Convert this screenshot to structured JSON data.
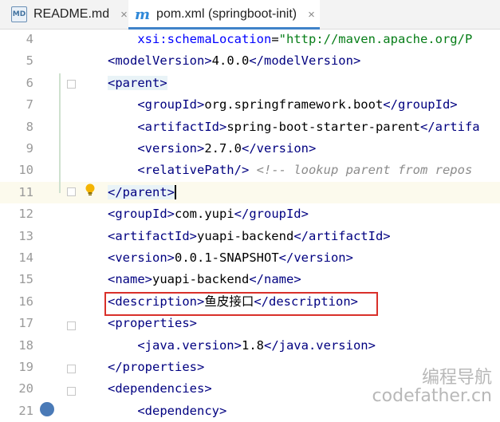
{
  "tabs": [
    {
      "label": "README.md",
      "icon": "markdown-file-icon",
      "close": "×"
    },
    {
      "label": "pom.xml (springboot-init)",
      "icon": "maven-m-icon",
      "close": "×"
    }
  ],
  "md_icon_text": "MD",
  "m_icon_text": "m",
  "lines": [
    {
      "n": "4",
      "t": "    xsi:schemaLocation=\"http://maven.apache.org/P"
    },
    {
      "n": "5",
      "t": "<modelVersion>4.0.0</modelVersion>"
    },
    {
      "n": "6",
      "t": "<parent>"
    },
    {
      "n": "7",
      "t": "    <groupId>org.springframework.boot</groupId>"
    },
    {
      "n": "8",
      "t": "    <artifactId>spring-boot-starter-parent</artifa"
    },
    {
      "n": "9",
      "t": "    <version>2.7.0</version>"
    },
    {
      "n": "10",
      "t": "    <relativePath/> <!-- lookup parent from repos"
    },
    {
      "n": "11",
      "t": "</parent>"
    },
    {
      "n": "12",
      "t": "<groupId>com.yupi</groupId>"
    },
    {
      "n": "13",
      "t": "<artifactId>yuapi-backend</artifactId>"
    },
    {
      "n": "14",
      "t": "<version>0.0.1-SNAPSHOT</version>"
    },
    {
      "n": "15",
      "t": "<name>yuapi-backend</name>"
    },
    {
      "n": "16",
      "t": "<description>鱼皮接口</description>"
    },
    {
      "n": "17",
      "t": "<properties>"
    },
    {
      "n": "18",
      "t": "    <java.version>1.8</java.version>"
    },
    {
      "n": "19",
      "t": "</properties>"
    },
    {
      "n": "20",
      "t": "<dependencies>"
    },
    {
      "n": "21",
      "t": "    <dependency>"
    }
  ],
  "watermark": {
    "line1": "编程导航",
    "line2": "codefather.cn"
  },
  "colors": {
    "tag": "#000080",
    "attr": "#0000ff",
    "string": "#067d17",
    "comment": "#8c8c8c",
    "highlight_box": "#d9302a"
  }
}
